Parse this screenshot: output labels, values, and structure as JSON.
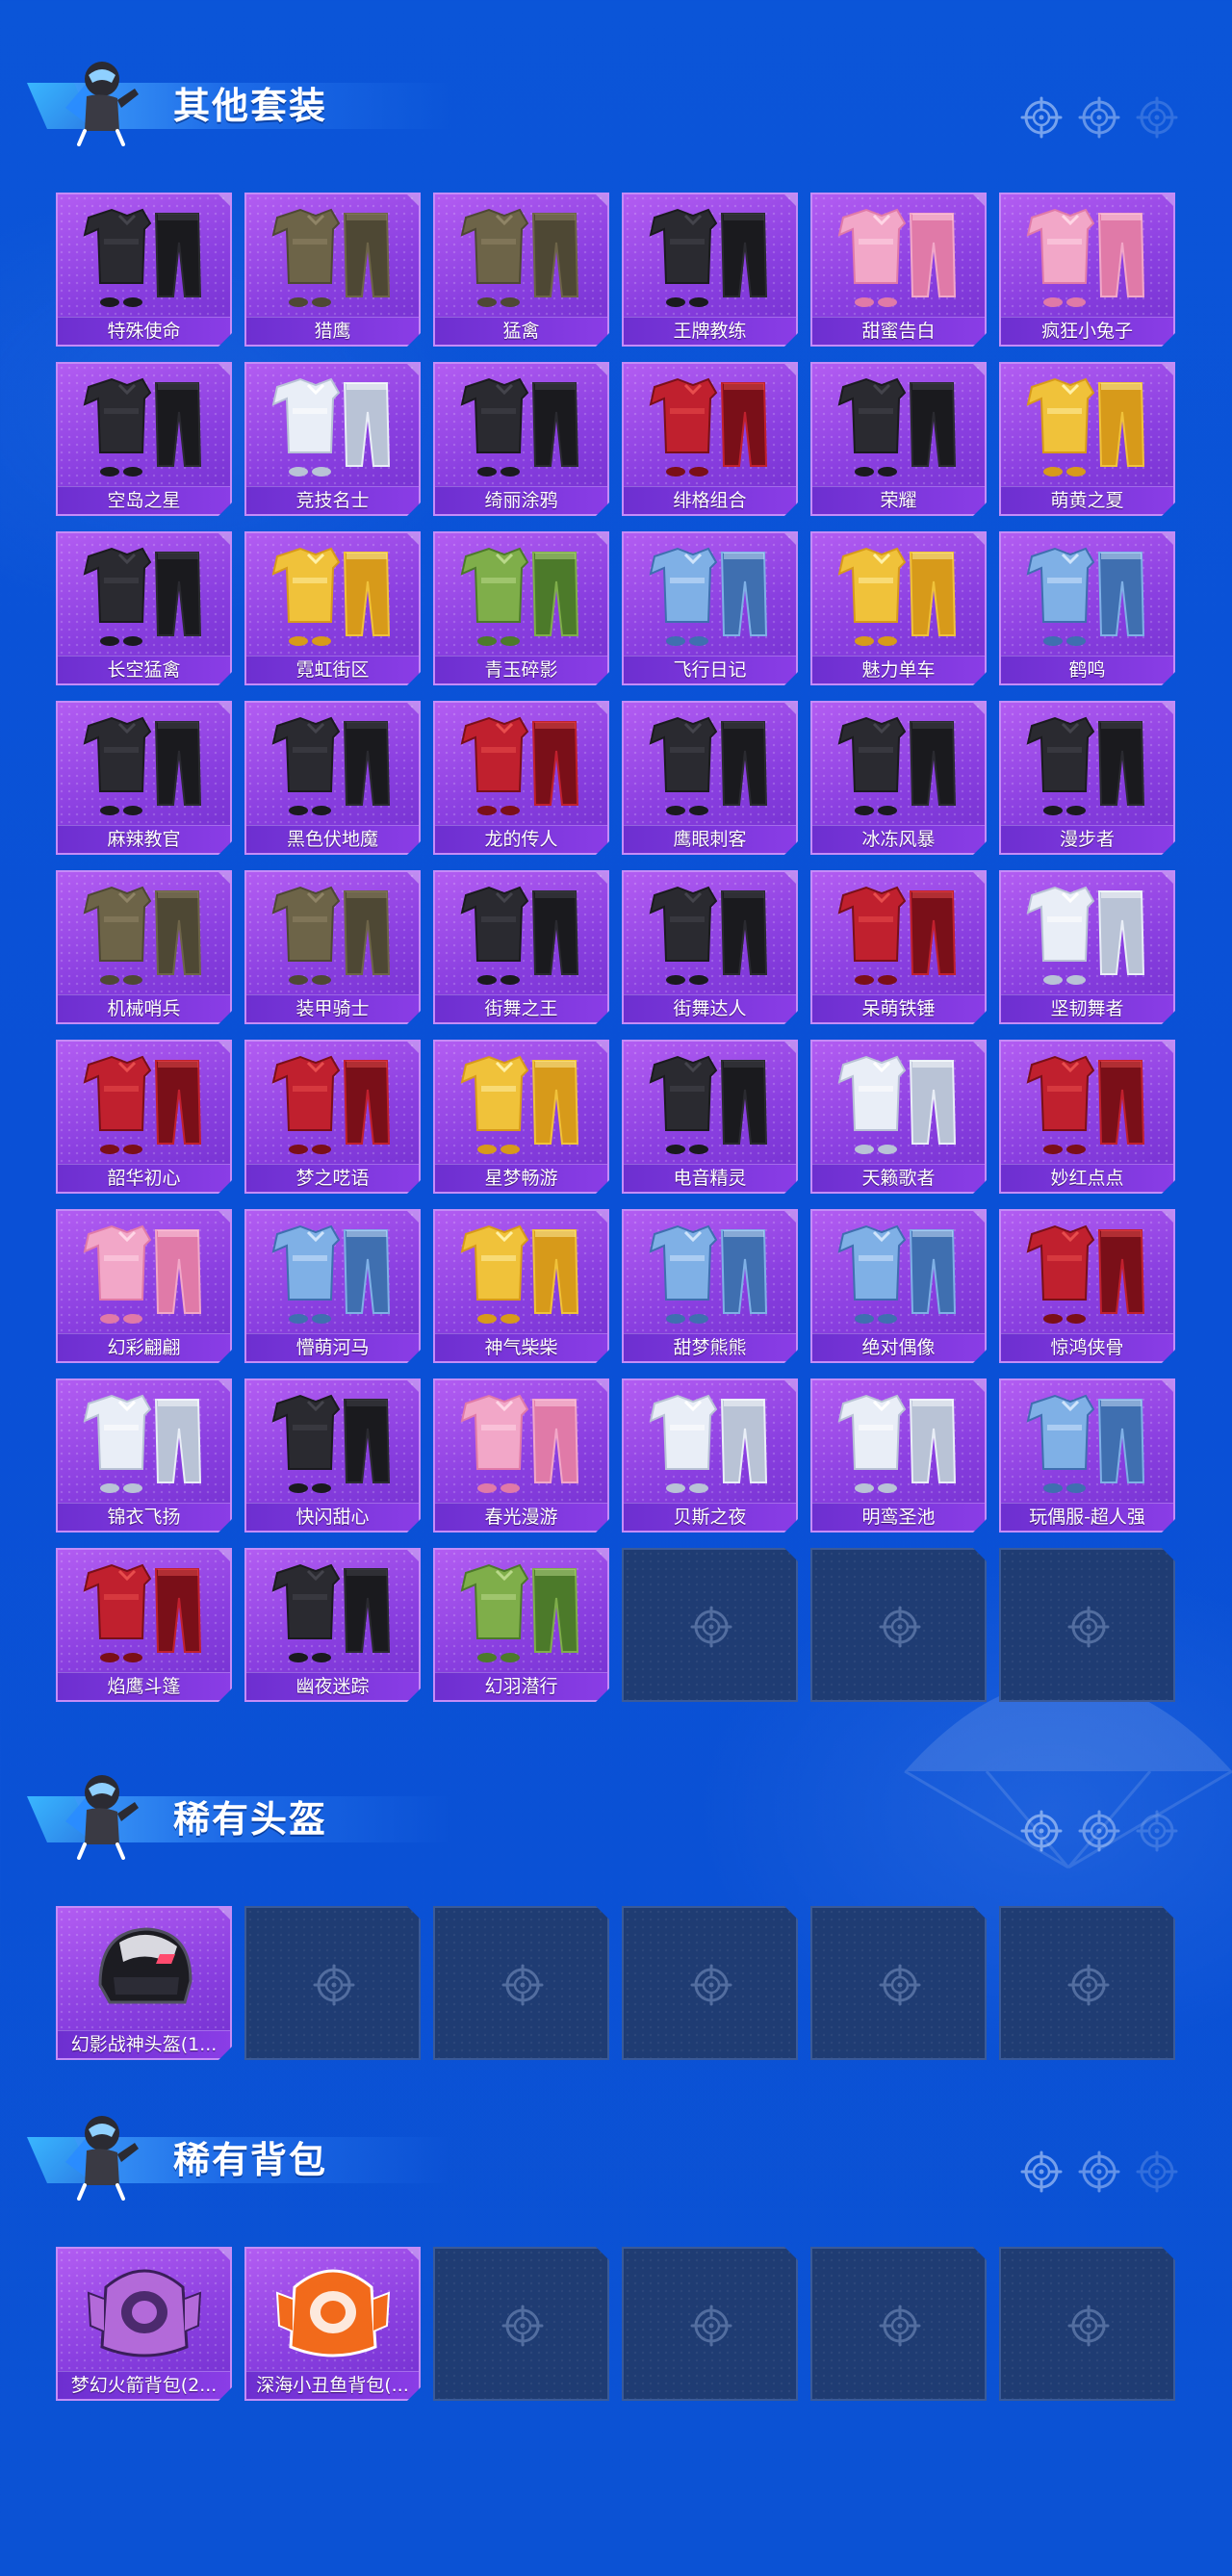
{
  "sections": [
    {
      "title": "其他套装",
      "items": [
        {
          "name": "特殊使命",
          "style": "dark"
        },
        {
          "name": "猎鹰",
          "style": "khaki"
        },
        {
          "name": "猛禽",
          "style": "khaki"
        },
        {
          "name": "王牌教练",
          "style": "dark"
        },
        {
          "name": "甜蜜告白",
          "style": "pink"
        },
        {
          "name": "疯狂小兔子",
          "style": "pink"
        },
        {
          "name": "空岛之星",
          "style": "dark"
        },
        {
          "name": "竞技名士",
          "style": "white"
        },
        {
          "name": "绮丽涂鸦",
          "style": "dark"
        },
        {
          "name": "绯格组合",
          "style": "red"
        },
        {
          "name": "荣耀",
          "style": "dark"
        },
        {
          "name": "萌黄之夏",
          "style": "yellow"
        },
        {
          "name": "长空猛禽",
          "style": "dark"
        },
        {
          "name": "霓虹街区",
          "style": "yellow"
        },
        {
          "name": "青玉碎影",
          "style": "green"
        },
        {
          "name": "飞行日记",
          "style": "blue"
        },
        {
          "name": "魅力单车",
          "style": "yellow"
        },
        {
          "name": "鹤鸣",
          "style": "blue"
        },
        {
          "name": "麻辣教官",
          "style": "dark"
        },
        {
          "name": "黑色伏地魔",
          "style": "dark"
        },
        {
          "name": "龙的传人",
          "style": "red"
        },
        {
          "name": "鹰眼刺客",
          "style": "dark"
        },
        {
          "name": "冰冻风暴",
          "style": "dark"
        },
        {
          "name": "漫步者",
          "style": "dark"
        },
        {
          "name": "机械哨兵",
          "style": "khaki"
        },
        {
          "name": "装甲骑士",
          "style": "khaki"
        },
        {
          "name": "街舞之王",
          "style": "dark"
        },
        {
          "name": "街舞达人",
          "style": "dark"
        },
        {
          "name": "呆萌铁锤",
          "style": "red"
        },
        {
          "name": "坚韧舞者",
          "style": "white"
        },
        {
          "name": "韶华初心",
          "style": "red"
        },
        {
          "name": "梦之呓语",
          "style": "red"
        },
        {
          "name": "星梦畅游",
          "style": "yellow"
        },
        {
          "name": "电音精灵",
          "style": "dark"
        },
        {
          "name": "天籁歌者",
          "style": "white"
        },
        {
          "name": "妙红点点",
          "style": "red"
        },
        {
          "name": "幻彩翩翩",
          "style": "pink"
        },
        {
          "name": "懵萌河马",
          "style": "blue"
        },
        {
          "name": "神气柴柴",
          "style": "yellow"
        },
        {
          "name": "甜梦熊熊",
          "style": "blue"
        },
        {
          "name": "绝对偶像",
          "style": "blue"
        },
        {
          "name": "惊鸿侠骨",
          "style": "red"
        },
        {
          "name": "锦衣飞扬",
          "style": "white"
        },
        {
          "name": "快闪甜心",
          "style": "dark"
        },
        {
          "name": "春光漫游",
          "style": "pink"
        },
        {
          "name": "贝斯之夜",
          "style": "white"
        },
        {
          "name": "明鸾圣池",
          "style": "white"
        },
        {
          "name": "玩偶服-超人强",
          "style": "blue"
        },
        {
          "name": "焰鹰斗篷",
          "style": "red"
        },
        {
          "name": "幽夜迷踪",
          "style": "dark"
        },
        {
          "name": "幻羽潜行",
          "style": "green"
        }
      ],
      "empty_slots": 3
    },
    {
      "title": "稀有头盔",
      "items": [
        {
          "name": "幻影战神头盔(1...",
          "style": "helmet"
        }
      ],
      "empty_slots": 5
    },
    {
      "title": "稀有背包",
      "items": [
        {
          "name": "梦幻火箭背包(2...",
          "style": "backpack-purple"
        },
        {
          "name": "深海小丑鱼背包(...",
          "style": "backpack-orange"
        }
      ],
      "empty_slots": 4
    }
  ],
  "colors": {
    "background": "#0b55d8",
    "tile_filled": "#9b4ce8",
    "tile_label": "#7a34d9",
    "tile_empty": "#1f3c73",
    "title": "#ffffff"
  },
  "icons": {
    "section_mascot": "parachuting-character-icon",
    "section_decoration": "crosshair-icon",
    "empty_slot": "crosshair-icon"
  }
}
